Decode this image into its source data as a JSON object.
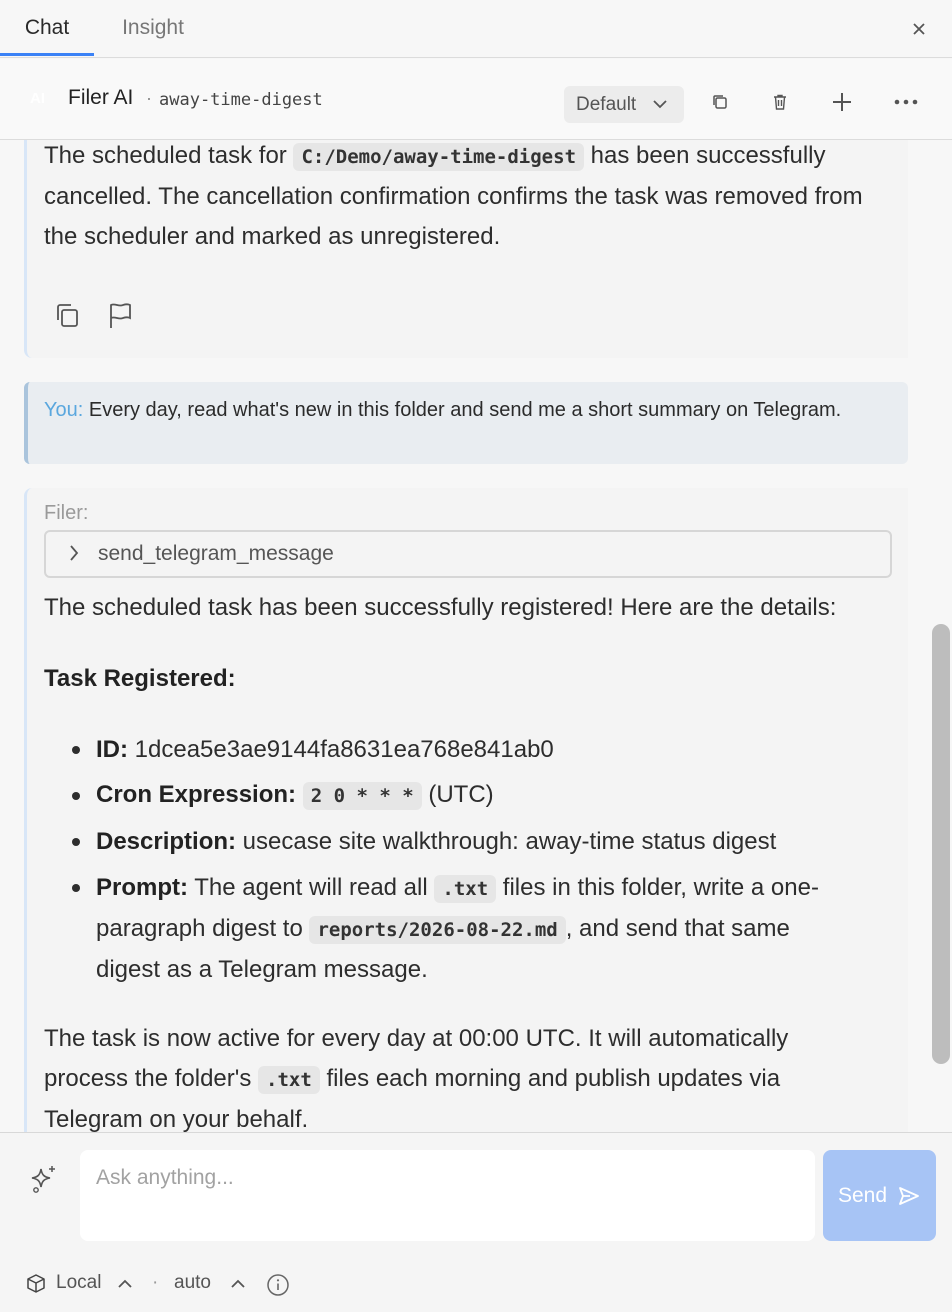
{
  "tabs": [
    {
      "label": "Chat",
      "active": true
    },
    {
      "label": "Insight",
      "active": false
    }
  ],
  "header": {
    "badge": "AI",
    "model_name": "Filer AI",
    "separator": "·",
    "subtitle": "away-time-digest",
    "dropdown_value": "Default"
  },
  "messages": {
    "prev": {
      "text_before": "The scheduled task for ",
      "code": "C:/Demo/away-time-digest",
      "text_after": " has been successfully cancelled. The cancellation confirmation confirms the task was removed from the scheduler and marked as unregistered."
    },
    "user": {
      "prefix": "You:",
      "text": " Every day, read what's new in this folder and send me a short summary on Telegram."
    },
    "reply": {
      "label": "Filer:",
      "tool_name": "send_telegram_message",
      "intro": "The scheduled task has been successfully registered! Here are the details:",
      "heading": "Task Registered:",
      "id_label": "ID:",
      "id_value": " 1dcea5e3ae9144fa8631ea768e841ab0",
      "cron_label": "Cron Expression:",
      "cron_code": "2 0 * * *",
      "cron_suffix": " (UTC)",
      "desc_label": "Description:",
      "desc_value": " usecase site walkthrough: away-time status digest",
      "prompt_label": "Prompt:",
      "prompt_part1": " The agent will read all ",
      "prompt_code1": ".txt",
      "prompt_part2": " files in this folder, write a one-",
      "prompt_part3": "paragraph digest to ",
      "prompt_code2": "reports/2026-08-22.md",
      "prompt_part4": ", and send that same",
      "prompt_part5": "digest as a Telegram message.",
      "outro_line1": "The task is now active for every day at 00:00 UTC. It will automatically",
      "outro_part2": "process the folder's ",
      "outro_code": ".txt",
      "outro_part3": " files each morning and publish updates via",
      "outro_line3": "Telegram on your behalf."
    }
  },
  "composer": {
    "placeholder": "Ask anything...",
    "send_label": "Send",
    "env_label": "Local",
    "separator": "·",
    "mode_label": "auto"
  },
  "colors": {
    "accent": "#3b82f6",
    "send_button": "#a7c4f5",
    "you_label": "#5aa7de"
  }
}
